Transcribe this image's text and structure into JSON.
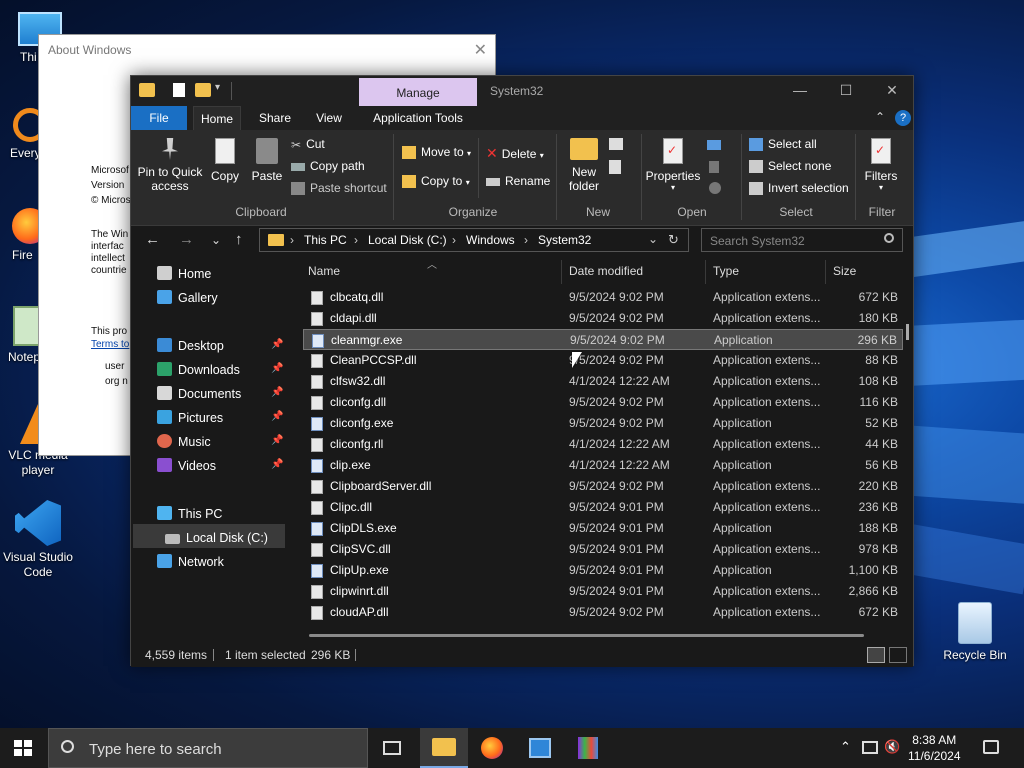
{
  "desktop": {
    "icons": [
      {
        "label": "This PC",
        "partial": "Thi"
      },
      {
        "label": "Every",
        "partial": "Every"
      },
      {
        "label": "Fire",
        "partial": "Fire"
      },
      {
        "label": "Notep",
        "partial": "Notep"
      },
      {
        "label": "VLC media player"
      },
      {
        "label": "Visual Studio Code"
      },
      {
        "label": "Recycle Bin"
      }
    ]
  },
  "about_window": {
    "title": "About Windows",
    "lines_a": [
      "Microsof",
      "Version",
      "© Micros"
    ],
    "lines_b": [
      "The Win",
      "interfac",
      "intellect",
      "countrie"
    ],
    "lines_c": [
      "This pro",
      "Terms to"
    ],
    "lines_d": [
      "user",
      "org n"
    ]
  },
  "explorer": {
    "title": "System32",
    "manage_tab": "Manage",
    "tabs": [
      "File",
      "Home",
      "Share",
      "View",
      "Application Tools"
    ],
    "ribbon": {
      "clipboard": {
        "label": "Clipboard",
        "pin": "Pin to Quick access",
        "pin_line1": "Pin to Quick",
        "pin_line2": "access",
        "copy": "Copy",
        "paste": "Paste",
        "cut": "Cut",
        "copy_path": "Copy path",
        "paste_shortcut": "Paste shortcut"
      },
      "organize": {
        "label": "Organize",
        "move_to": "Move to",
        "copy_to": "Copy to",
        "delete": "Delete",
        "rename": "Rename"
      },
      "new": {
        "label": "New",
        "new_folder_line1": "New",
        "new_folder_line2": "folder"
      },
      "open": {
        "label": "Open",
        "properties": "Properties"
      },
      "select": {
        "label": "Select",
        "select_all": "Select all",
        "select_none": "Select none",
        "invert": "Invert selection"
      },
      "filter": {
        "label": "Filter",
        "filters": "Filters"
      }
    },
    "address": {
      "crumbs": [
        "This PC",
        "Local Disk (C:)",
        "Windows",
        "System32"
      ],
      "search_placeholder": "Search System32"
    },
    "nav": {
      "home": "Home",
      "gallery": "Gallery",
      "desktop": "Desktop",
      "downloads": "Downloads",
      "documents": "Documents",
      "pictures": "Pictures",
      "music": "Music",
      "videos": "Videos",
      "this_pc": "This PC",
      "local_disk": "Local Disk (C:)",
      "network": "Network"
    },
    "columns": {
      "name": "Name",
      "date": "Date modified",
      "type": "Type",
      "size": "Size"
    },
    "files": [
      {
        "name": "clbcatq.dll",
        "date": "9/5/2024 9:02 PM",
        "type": "Application extens...",
        "size": "672 KB",
        "kind": "dll"
      },
      {
        "name": "cldapi.dll",
        "date": "9/5/2024 9:02 PM",
        "type": "Application extens...",
        "size": "180 KB",
        "kind": "dll"
      },
      {
        "name": "cleanmgr.exe",
        "date": "9/5/2024 9:02 PM",
        "type": "Application",
        "size": "296 KB",
        "kind": "exe",
        "selected": true
      },
      {
        "name": "CleanPCCSP.dll",
        "date": "9/5/2024 9:02 PM",
        "type": "Application extens...",
        "size": "88 KB",
        "kind": "dll"
      },
      {
        "name": "clfsw32.dll",
        "date": "4/1/2024 12:22 AM",
        "type": "Application extens...",
        "size": "108 KB",
        "kind": "dll"
      },
      {
        "name": "cliconfg.dll",
        "date": "9/5/2024 9:02 PM",
        "type": "Application extens...",
        "size": "116 KB",
        "kind": "dll"
      },
      {
        "name": "cliconfg.exe",
        "date": "9/5/2024 9:02 PM",
        "type": "Application",
        "size": "52 KB",
        "kind": "exe"
      },
      {
        "name": "cliconfg.rll",
        "date": "4/1/2024 12:22 AM",
        "type": "Application extens...",
        "size": "44 KB",
        "kind": "dll"
      },
      {
        "name": "clip.exe",
        "date": "4/1/2024 12:22 AM",
        "type": "Application",
        "size": "56 KB",
        "kind": "exe"
      },
      {
        "name": "ClipboardServer.dll",
        "date": "9/5/2024 9:02 PM",
        "type": "Application extens...",
        "size": "220 KB",
        "kind": "dll"
      },
      {
        "name": "Clipc.dll",
        "date": "9/5/2024 9:01 PM",
        "type": "Application extens...",
        "size": "236 KB",
        "kind": "dll"
      },
      {
        "name": "ClipDLS.exe",
        "date": "9/5/2024 9:01 PM",
        "type": "Application",
        "size": "188 KB",
        "kind": "exe"
      },
      {
        "name": "ClipSVC.dll",
        "date": "9/5/2024 9:01 PM",
        "type": "Application extens...",
        "size": "978 KB",
        "kind": "dll"
      },
      {
        "name": "ClipUp.exe",
        "date": "9/5/2024 9:01 PM",
        "type": "Application",
        "size": "1,100 KB",
        "kind": "exe"
      },
      {
        "name": "clipwinrt.dll",
        "date": "9/5/2024 9:01 PM",
        "type": "Application extens...",
        "size": "2,866 KB",
        "kind": "dll"
      },
      {
        "name": "cloudAP.dll",
        "date": "9/5/2024 9:02 PM",
        "type": "Application extens...",
        "size": "672 KB",
        "kind": "dll"
      }
    ],
    "status": {
      "items": "4,559 items",
      "selected": "1 item selected",
      "selected_size": "296 KB"
    }
  },
  "taskbar": {
    "search_placeholder": "Type here to search",
    "time": "8:38 AM",
    "date": "11/6/2024"
  }
}
